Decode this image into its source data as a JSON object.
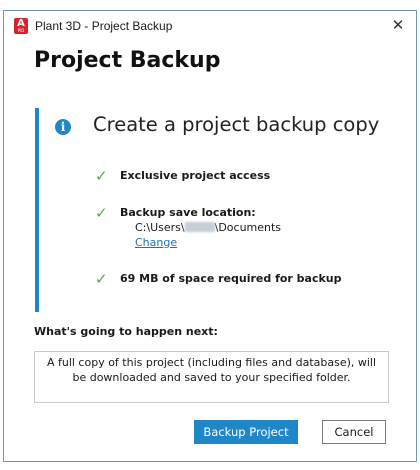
{
  "window": {
    "title": "Plant 3D - Project Backup",
    "app_icon": {
      "letter": "A",
      "sub": "PID",
      "color": "#d8232a"
    },
    "close_glyph": "✕"
  },
  "dialog": {
    "heading": "Project Backup",
    "callout": {
      "icon": "info-icon",
      "title": "Create a project backup copy",
      "items": [
        {
          "label": "Exclusive project access"
        },
        {
          "label": "Backup save location:",
          "path_prefix": "C:\\Users\\",
          "path_suffix": "\\Documents",
          "link": "Change"
        },
        {
          "label": "69 MB of space required for backup"
        }
      ]
    },
    "next_label": "What's going to happen next:",
    "next_text": "A full copy of this project (including files and database), will be downloaded and saved to your specified folder."
  },
  "buttons": {
    "primary": "Backup Project",
    "secondary": "Cancel"
  },
  "colors": {
    "accent": "#1f86c8",
    "check": "#5aa64f",
    "link": "#1f6fb5",
    "window_border": "#6e94b8"
  }
}
